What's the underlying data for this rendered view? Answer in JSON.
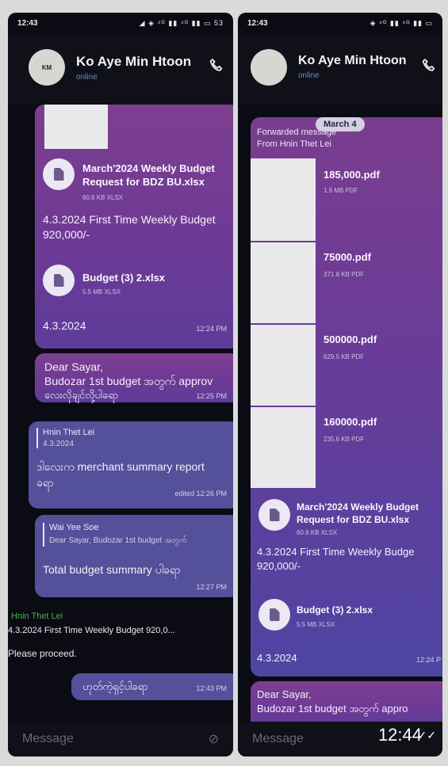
{
  "left": {
    "status": {
      "time": "12:43",
      "icons": "◢ ◈ ⁴ᴳ ▮▮ ⁴ᴳ ▮▮ ▭ 53"
    },
    "header": {
      "avatar": "KM",
      "name": "Ko Aye Min Htoon",
      "status": "online"
    },
    "file1": {
      "name_line1": "March'2024 Weekly Budget",
      "name_line2": "Request for  BDZ BU.xlsx",
      "size": "60.8 KB XLSX"
    },
    "msg1_line1": "4.3.2024 First Time Weekly Budget",
    "msg1_line2": "920,000/-",
    "file2": {
      "name": "Budget (3) 2.xlsx",
      "size": "5.5 MB XLSX"
    },
    "msg2_text": "4.3.2024",
    "msg2_time": "12:24 PM",
    "msg3": {
      "line1": "Dear Sayar,",
      "line2": "Budozar 1st budget အတွက် approv",
      "line3": "လေးလိုချင်လို့ပါခရာ",
      "time": "12:25 PM"
    },
    "msg4": {
      "quote_name": "Hnin Thet Lei",
      "quote_text": "4.3.2024",
      "line1": "ဒါလေးက merchant summary report",
      "line2": "ခရာ",
      "meta": "edited 12:26 PM"
    },
    "msg5": {
      "quote_name": "Wai Yee Soe",
      "quote_text": "Dear Sayar, Budozar 1st budget အတွက်",
      "text": "Total budget summary ပါခရာ",
      "time": "12:27 PM"
    },
    "reply": {
      "name": "Hnin Thet Lei",
      "text": "4.3.2024 First Time Weekly Budget 920,0...",
      "body": "Please proceed."
    },
    "out_msg": {
      "text": "ဟုတ်ကဲ့ရှင့်ပါခရာ",
      "time": "12:43 PM"
    },
    "input_placeholder": "Message"
  },
  "right": {
    "status": {
      "time": "12:43",
      "icons": "◈ ⁴ᴳ ▮▮ ⁴ᴳ ▮▮ ▭"
    },
    "header": {
      "avatar": "",
      "name": "Ko Aye Min Htoon",
      "status": "online"
    },
    "date_badge": "March 4",
    "forwarded_line1": "Forwarded message",
    "forwarded_line2": "From Hnin Thet Lei",
    "pdfs": [
      {
        "name": "185,000.pdf",
        "size": "1.9 MB PDF"
      },
      {
        "name": "75000.pdf",
        "size": "371.8 KB PDF"
      },
      {
        "name": "500000.pdf",
        "size": "629.5 KB PDF"
      },
      {
        "name": "160000.pdf",
        "size": "235.6 KB PDF"
      }
    ],
    "file1": {
      "name_line1": "March'2024 Weekly Budget",
      "name_line2": "Request for  BDZ BU.xlsx",
      "size": "60.8 KB XLSX"
    },
    "msg1_line1": "4.3.2024 First Time Weekly Budge",
    "msg1_line2": "920,000/-",
    "file2": {
      "name": "Budget (3) 2.xlsx",
      "size": "5.5 MB XLSX"
    },
    "msg2_text": "4.3.2024",
    "msg2_time": "12:24 P",
    "msg3": {
      "line1": "Dear Sayar,",
      "line2": "Budozar 1st budget အတွက် appro"
    },
    "input_placeholder": "Message",
    "overlay_time": "12:44",
    "read_checks": "✓✓"
  },
  "colors": {
    "bubble_purple": "#7d3f8f",
    "bubble_lavender": "#55509a",
    "online_blue": "#5e8fcf",
    "reply_green": "#4caf50"
  }
}
